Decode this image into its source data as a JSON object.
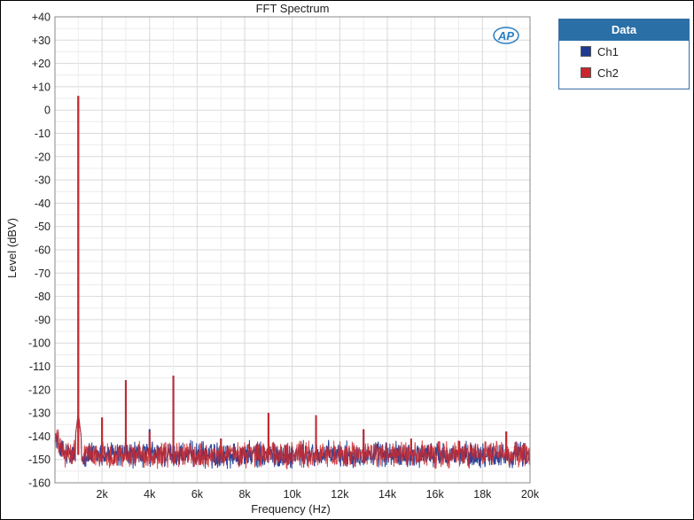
{
  "colors": {
    "ch1": "#1f3a93",
    "ch2": "#c8282d",
    "grid": "#d9d9d9",
    "logo": "#2a7fc4"
  },
  "legend": {
    "header": "Data",
    "items": [
      {
        "label": "Ch1",
        "color": "#1f3a93"
      },
      {
        "label": "Ch2",
        "color": "#c8282d"
      }
    ]
  },
  "logo": {
    "text": "AP",
    "icon": "ap-logo-icon"
  },
  "chart_data": {
    "type": "line",
    "title": "FFT Spectrum",
    "xlabel": "Frequency (Hz)",
    "ylabel": "Level (dBV)",
    "xlim": [
      20,
      20000
    ],
    "ylim": [
      -160,
      40
    ],
    "x_ticks": [
      {
        "value": 2000,
        "label": "2k"
      },
      {
        "value": 4000,
        "label": "4k"
      },
      {
        "value": 6000,
        "label": "6k"
      },
      {
        "value": 8000,
        "label": "8k"
      },
      {
        "value": 10000,
        "label": "10k"
      },
      {
        "value": 12000,
        "label": "12k"
      },
      {
        "value": 14000,
        "label": "14k"
      },
      {
        "value": 16000,
        "label": "16k"
      },
      {
        "value": 18000,
        "label": "18k"
      },
      {
        "value": 20000,
        "label": "20k"
      }
    ],
    "y_ticks": [
      {
        "value": 40,
        "label": "+40"
      },
      {
        "value": 30,
        "label": "+30"
      },
      {
        "value": 20,
        "label": "+20"
      },
      {
        "value": 10,
        "label": "+10"
      },
      {
        "value": 0,
        "label": "0"
      },
      {
        "value": -10,
        "label": "-10"
      },
      {
        "value": -20,
        "label": "-20"
      },
      {
        "value": -30,
        "label": "-30"
      },
      {
        "value": -40,
        "label": "-40"
      },
      {
        "value": -50,
        "label": "-50"
      },
      {
        "value": -60,
        "label": "-60"
      },
      {
        "value": -70,
        "label": "-70"
      },
      {
        "value": -80,
        "label": "-80"
      },
      {
        "value": -90,
        "label": "-90"
      },
      {
        "value": -100,
        "label": "-100"
      },
      {
        "value": -110,
        "label": "-110"
      },
      {
        "value": -120,
        "label": "-120"
      },
      {
        "value": -130,
        "label": "-130"
      },
      {
        "value": -140,
        "label": "-140"
      },
      {
        "value": -150,
        "label": "-150"
      },
      {
        "value": -160,
        "label": "-160"
      }
    ],
    "grid": true,
    "noise_floor_db": -148,
    "series": [
      {
        "name": "Ch1",
        "color": "#1f3a93",
        "peaks": [
          {
            "x": 1000,
            "y": 6
          },
          {
            "x": 2000,
            "y": -132
          },
          {
            "x": 3000,
            "y": -116
          },
          {
            "x": 4000,
            "y": -137
          },
          {
            "x": 5000,
            "y": -114
          },
          {
            "x": 7000,
            "y": -141
          },
          {
            "x": 9000,
            "y": -130
          },
          {
            "x": 11000,
            "y": -132
          },
          {
            "x": 13000,
            "y": -137
          },
          {
            "x": 15000,
            "y": -142
          },
          {
            "x": 17000,
            "y": -142
          },
          {
            "x": 19000,
            "y": -138
          }
        ]
      },
      {
        "name": "Ch2",
        "color": "#c8282d",
        "peaks": [
          {
            "x": 1000,
            "y": 6
          },
          {
            "x": 2000,
            "y": -132
          },
          {
            "x": 3000,
            "y": -116
          },
          {
            "x": 4000,
            "y": -138
          },
          {
            "x": 5000,
            "y": -114
          },
          {
            "x": 7000,
            "y": -141
          },
          {
            "x": 9000,
            "y": -130
          },
          {
            "x": 11000,
            "y": -131
          },
          {
            "x": 13000,
            "y": -137
          },
          {
            "x": 15000,
            "y": -141
          },
          {
            "x": 17000,
            "y": -142
          },
          {
            "x": 19000,
            "y": -138
          }
        ]
      }
    ]
  }
}
